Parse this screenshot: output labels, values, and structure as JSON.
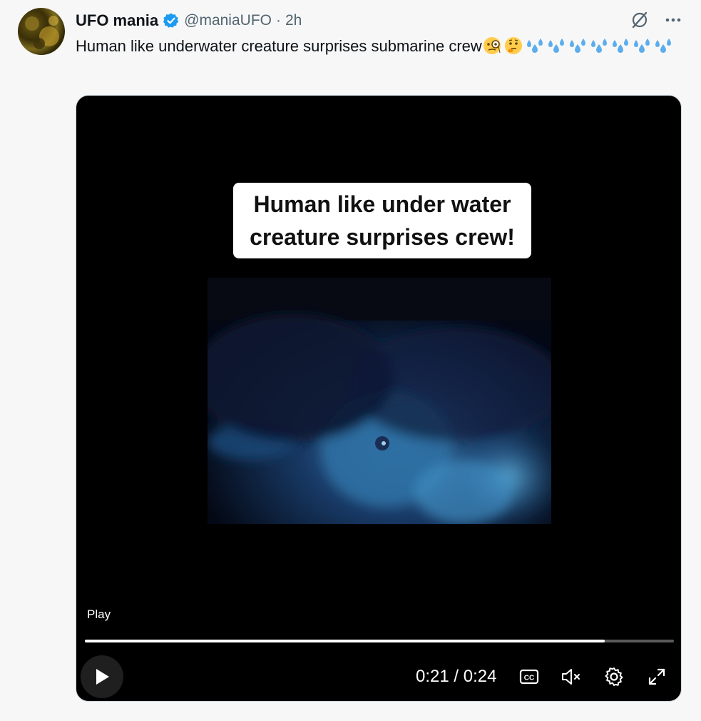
{
  "tweet": {
    "author_name": "UFO mania",
    "handle": "@maniaUFO",
    "separator": "·",
    "time": "2h",
    "text": "Human like underwater creature surprises submarine crew",
    "emojis": [
      "monocle-face",
      "thinking-face",
      "sweat-droplets",
      "sweat-droplets",
      "sweat-droplets",
      "sweat-droplets",
      "sweat-droplets",
      "sweat-droplets",
      "sweat-droplets"
    ]
  },
  "icons": {
    "grok": "grok-icon",
    "more": "more-icon",
    "verified": "verified-badge-icon"
  },
  "video": {
    "caption_line1": "Human like under water",
    "caption_line2": "creature surprises crew!",
    "play_label": "Play",
    "current_time": "0:21",
    "duration": "0:24",
    "time_display": "0:21 / 0:24",
    "progress": 0.883,
    "captions_icon": "cc-icon",
    "mute_icon": "muted-speaker-icon",
    "settings_icon": "gear-icon",
    "fullscreen_icon": "expand-icon"
  },
  "colors": {
    "verified": "#1d9bf0",
    "text": "#0f1419",
    "secondary": "#536471",
    "droplet": "#5dadec"
  }
}
